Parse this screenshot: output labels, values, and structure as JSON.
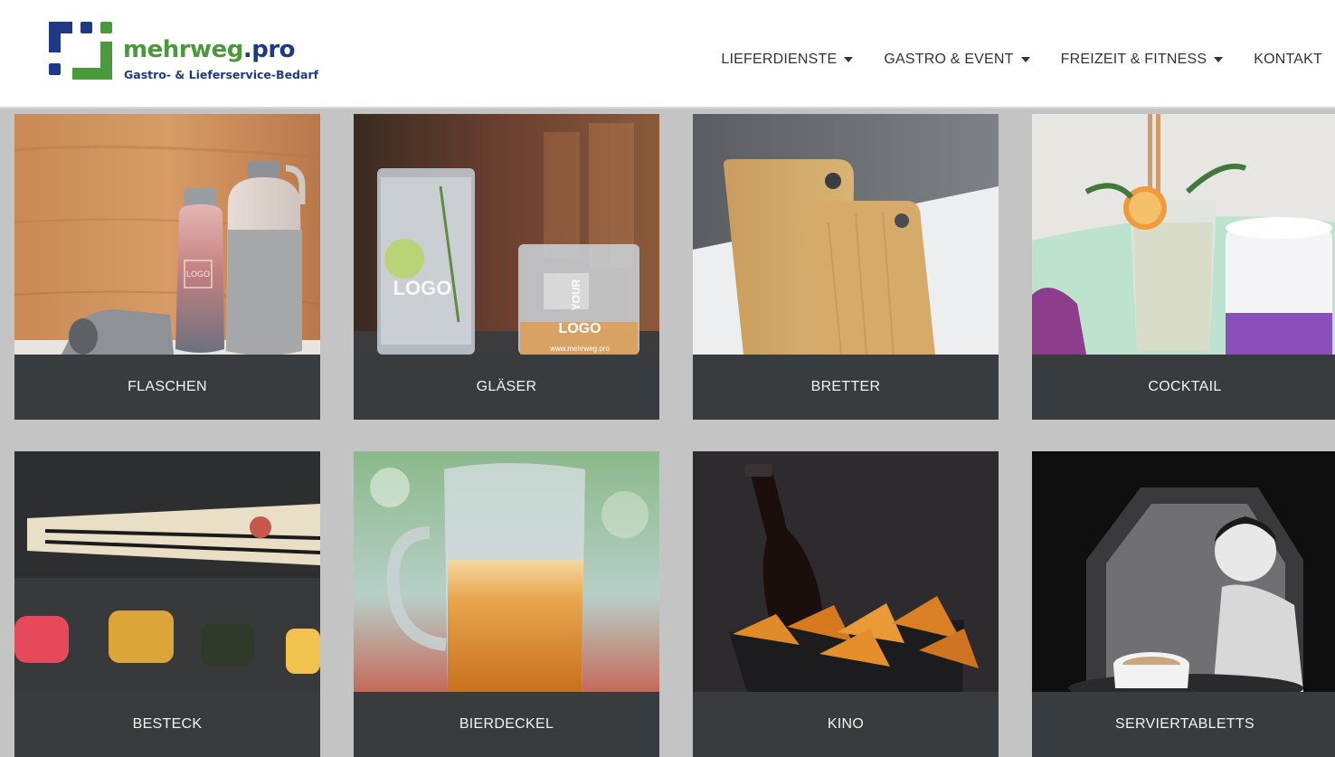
{
  "brand": {
    "word_part1": "mehrweg",
    "word_part2": ".pro",
    "tagline": "Gastro- & Lieferservice-Bedarf",
    "colors": {
      "green": "#4a9a3a",
      "navy": "#1e3a86"
    }
  },
  "nav": {
    "items": [
      {
        "label": "LIEFERDIENSTE",
        "dropdown": true
      },
      {
        "label": "GASTRO & EVENT",
        "dropdown": true
      },
      {
        "label": "FREIZEIT & FITNESS",
        "dropdown": true
      },
      {
        "label": "KONTAKT",
        "dropdown": false
      }
    ]
  },
  "tiles": [
    {
      "label": "FLASCHEN",
      "image": "bottles-photo",
      "image_text": [
        "LOGO"
      ]
    },
    {
      "label": "GLÄSER",
      "image": "glasses-photo",
      "image_text": [
        "LOGO",
        "YOUR",
        "LOGO",
        "www.mehrweg.pro"
      ]
    },
    {
      "label": "BRETTER",
      "image": "cutting-boards-photo"
    },
    {
      "label": "COCKTAIL",
      "image": "cocktail-photo"
    },
    {
      "label": "BESTECK",
      "image": "chopsticks-sushi-photo"
    },
    {
      "label": "BIERDECKEL",
      "image": "beer-mug-photo"
    },
    {
      "label": "KINO",
      "image": "beer-bottle-nachos-photo"
    },
    {
      "label": "SERVIERTABLETTS",
      "image": "serving-tray-photo"
    }
  ],
  "colors": {
    "page_background": "#c4c4c4",
    "tile_label_background": "#393c3e",
    "tile_label_text": "#f2f2f2",
    "nav_text": "#333333"
  }
}
